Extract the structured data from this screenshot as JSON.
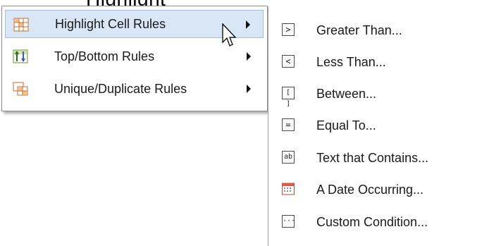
{
  "heading_partial": "Highlight",
  "menu": {
    "items": [
      {
        "label": "Highlight Cell Rules",
        "icon": "highlight-cells-icon",
        "has_submenu": true,
        "highlighted": true
      },
      {
        "label": "Top/Bottom Rules",
        "icon": "top-bottom-icon",
        "has_submenu": true,
        "highlighted": false
      },
      {
        "label": "Unique/Duplicate Rules",
        "icon": "unique-duplicate-icon",
        "has_submenu": true,
        "highlighted": false
      }
    ]
  },
  "submenu": {
    "items": [
      {
        "label": "Greater Than...",
        "glyph": ">",
        "icon": "greater-than-icon"
      },
      {
        "label": "Less Than...",
        "glyph": "<",
        "icon": "less-than-icon"
      },
      {
        "label": "Between...",
        "glyph": "[ ]",
        "icon": "between-icon"
      },
      {
        "label": "Equal To...",
        "glyph": "=",
        "icon": "equal-to-icon"
      },
      {
        "label": "Text that Contains...",
        "glyph": "ab",
        "icon": "text-contains-icon"
      },
      {
        "label": "A Date Occurring...",
        "glyph": "",
        "icon": "calendar-icon"
      },
      {
        "label": "Custom Condition...",
        "glyph": "···",
        "icon": "custom-condition-icon"
      }
    ]
  },
  "colors": {
    "highlight_bg": "#d8e6f5",
    "highlight_border": "#9ebfe3",
    "menu_border": "#8e8e8e"
  }
}
